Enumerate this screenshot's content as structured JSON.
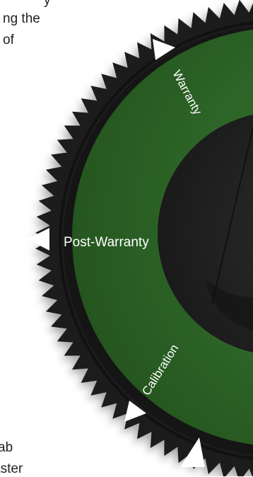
{
  "top_text": {
    "lines": [
      "y",
      "ng the",
      "of"
    ]
  },
  "bottom_text": {
    "lines": [
      "ab",
      "aster"
    ]
  },
  "dial": {
    "segments": [
      "Warranty",
      "Post-Warranty",
      "Calibration"
    ],
    "colors": {
      "outer_ring": "#1b1b1b",
      "gear_teeth": "#2a2a2a",
      "green_band": "#2f6a2c",
      "inner_hub": "#242424",
      "pointer": "#ffffff"
    }
  }
}
